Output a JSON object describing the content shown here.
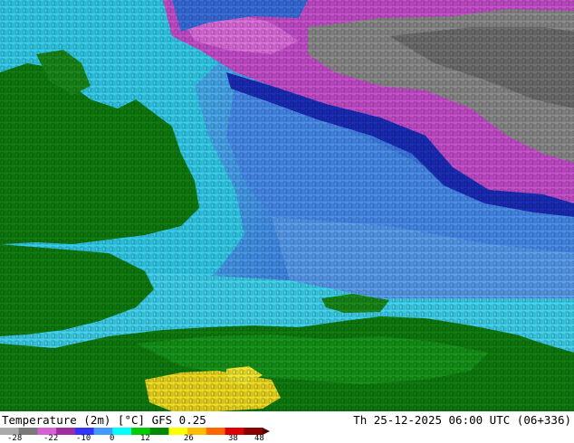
{
  "map": {
    "title": "Temperature (2m) [°C] GFS 0.25",
    "valid_time": "Th 25-12-2025 06:00 UTC (06+336)"
  },
  "legend": {
    "ticks": [
      "-28",
      "-22",
      "-10",
      "0",
      "12",
      "26",
      "38",
      "48"
    ],
    "colors": [
      "#aaaaaa",
      "#7a7a7a",
      "#d760d7",
      "#a02ca0",
      "#3333ff",
      "#4499ff",
      "#00ffff",
      "#00cc00",
      "#008800",
      "#ffff00",
      "#ffbb00",
      "#ff6600",
      "#dd0000",
      "#880000"
    ]
  },
  "palette": {
    "land": "#0f7e0f",
    "land_light": "#119a11",
    "sea_cyan": "#33ccee",
    "sea_light": "#66ddee",
    "sea_blue": "#3a7ae8",
    "deep_blue": "#1022b0",
    "magenta": "#cc55cc",
    "grey": "#8a8a8a",
    "yellow": "#f2e020"
  }
}
